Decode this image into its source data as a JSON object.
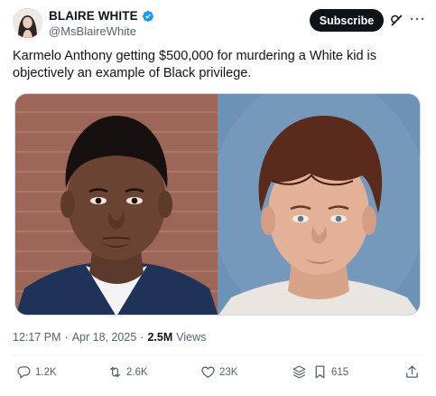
{
  "author": {
    "name": "BLAIRE WHITE",
    "handle": "@MsBlaireWhite",
    "verified": true
  },
  "header": {
    "subscribe_label": "Subscribe"
  },
  "tweet": {
    "text": "Karmelo Anthony getting $500,000 for murdering a White kid is objectively an example of Black privilege."
  },
  "meta": {
    "time": "12:17 PM",
    "separator": "·",
    "date": "Apr 18, 2025",
    "views_count": "2.5M",
    "views_label": "Views"
  },
  "actions": {
    "replies": "1.2K",
    "reposts": "2.6K",
    "likes": "23K",
    "bookmarks": "615"
  },
  "colors": {
    "verified": "#1d9bf0",
    "text_secondary": "#536471",
    "subscribe_bg": "#0f1419"
  },
  "icons": [
    "verified-badge-icon",
    "grok-icon",
    "more-icon",
    "reply-icon",
    "repost-icon",
    "like-icon",
    "views-stack-icon",
    "bookmark-icon",
    "share-icon"
  ]
}
